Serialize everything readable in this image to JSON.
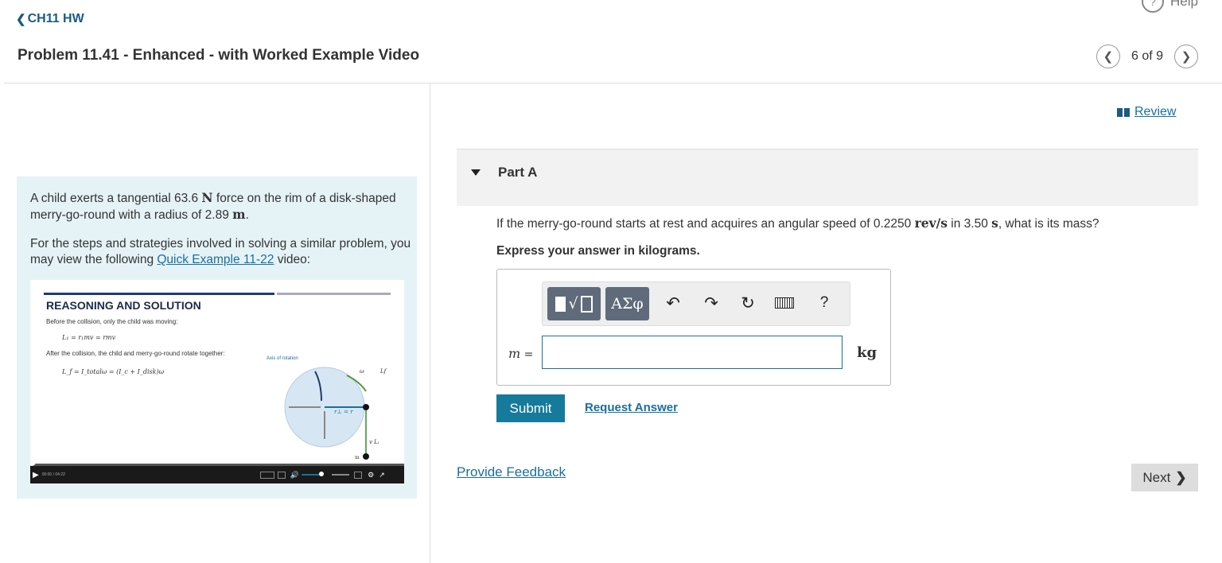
{
  "header": {
    "back_label": "CH11 HW",
    "help_label": "Help",
    "title": "Problem 11.41 - Enhanced - with Worked Example Video",
    "pager": "6 of 9"
  },
  "problem": {
    "p1_a": "A child exerts a tangential 63.6 ",
    "p1_unit1": "N",
    "p1_b": " force on the rim of a disk-shaped merry-go-round with a radius of 2.89 ",
    "p1_unit2": "m",
    "p1_c": ".",
    "p2_a": "For the steps and strategies involved in solving a similar problem, you may view the following ",
    "p2_link": "Quick Example 11-22",
    "p2_b": " video:"
  },
  "video": {
    "heading": "REASONING AND SOLUTION",
    "line1": "Before the collision, only the child was moving:",
    "eq1": "L₁ = r₁mv = rmv",
    "line2": "After the collision, the child and merry-go-round rotate together:",
    "eq2": "L_f = I_totalω = (I_c + I_disk)ω",
    "axis_label": "Axis of rotation",
    "omega": "ω",
    "lf": "Lf",
    "r_label": "r⊥ = r",
    "v_label": "v  Lᵢ",
    "m_label": "m",
    "time": "00:00 / 04:22"
  },
  "review_label": "Review",
  "part": {
    "label": "Part A",
    "q_a": "If the merry-go-round starts at rest and acquires an angular speed of 0.2250 ",
    "q_unit": "rev/s",
    "q_b": " in 3.50 ",
    "q_unit2": "s",
    "q_c": ", what is its mass?",
    "express": "Express your answer in kilograms."
  },
  "answer": {
    "var": "m",
    "eq": " =",
    "value": "",
    "unit": "kg",
    "tools": {
      "greek": "ΑΣφ",
      "help": "?"
    }
  },
  "buttons": {
    "submit": "Submit",
    "request": "Request Answer",
    "feedback": "Provide Feedback",
    "next": "Next"
  }
}
